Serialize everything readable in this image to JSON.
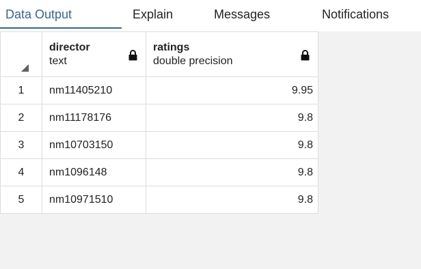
{
  "tabs": [
    {
      "label": "Data Output",
      "active": true
    },
    {
      "label": "Explain",
      "active": false
    },
    {
      "label": "Messages",
      "active": false
    },
    {
      "label": "Notifications",
      "active": false
    }
  ],
  "columns": [
    {
      "name": "director",
      "type": "text",
      "locked": true
    },
    {
      "name": "ratings",
      "type": "double precision",
      "locked": true
    }
  ],
  "rows": [
    {
      "num": "1",
      "director": "nm11405210",
      "ratings": "9.95"
    },
    {
      "num": "2",
      "director": "nm11178176",
      "ratings": "9.8"
    },
    {
      "num": "3",
      "director": "nm10703150",
      "ratings": "9.8"
    },
    {
      "num": "4",
      "director": "nm1096148",
      "ratings": "9.8"
    },
    {
      "num": "5",
      "director": "nm10971510",
      "ratings": "9.8"
    }
  ],
  "colors": {
    "accent": "#326690",
    "border": "#dcdcdc",
    "empty_area": "#f2f2f2"
  },
  "icons": {
    "lock": "lock-icon",
    "corner": "select-all-corner-icon"
  }
}
